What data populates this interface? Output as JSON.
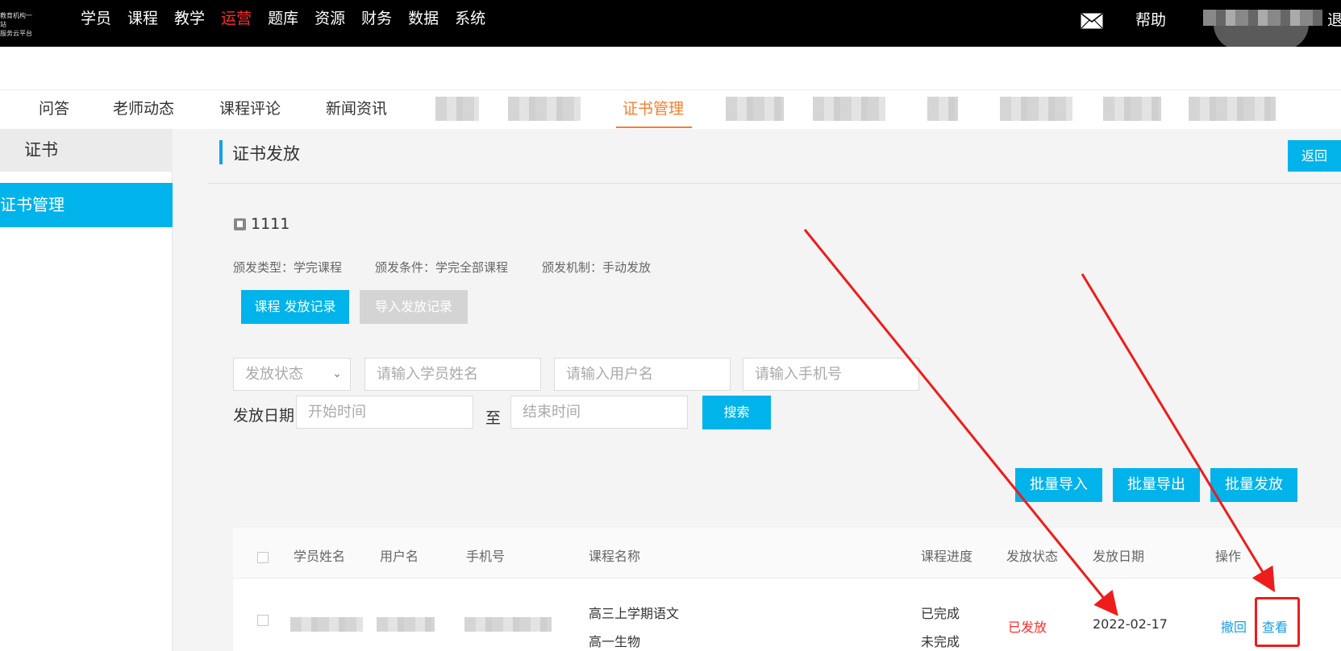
{
  "topnav": {
    "items": [
      "学员",
      "课程",
      "教学",
      "运营",
      "题库",
      "资源",
      "财务",
      "数据",
      "系统"
    ],
    "active": "运营",
    "help": "帮助",
    "logout": "退",
    "logo_line1": "教育机构一站",
    "logo_line2": "服务云平台"
  },
  "subtabs": {
    "items": [
      "问答",
      "老师动态",
      "课程评论",
      "新闻资讯",
      "证书管理"
    ],
    "active": "证书管理"
  },
  "sidebar": {
    "header": "证书",
    "items": [
      "证书管理"
    ]
  },
  "page": {
    "title": "证书发放",
    "back": "返回"
  },
  "certificate": {
    "name": "1111",
    "type_label": "颁发类型：学完课程",
    "condition_label": "颁发条件：学完全部课程",
    "mechanism_label": "颁发机制：手动发放"
  },
  "record_tabs": {
    "course_records": "课程 发放记录",
    "import_records": "导入发放记录"
  },
  "filters": {
    "status_placeholder": "发放状态",
    "student_placeholder": "请输入学员姓名",
    "username_placeholder": "请输入用户名",
    "phone_placeholder": "请输入手机号",
    "date_label": "发放日期",
    "start_placeholder": "开始时间",
    "to_label": "至",
    "end_placeholder": "结束时间",
    "search": "搜索"
  },
  "bulk_actions": {
    "import": "批量导入",
    "export": "批量导出",
    "issue": "批量发放"
  },
  "table": {
    "columns": [
      "学员姓名",
      "用户名",
      "手机号",
      "课程名称",
      "课程进度",
      "发放状态",
      "发放日期",
      "操作"
    ],
    "rows": [
      {
        "courses": [
          "高三上学期语文",
          "高一生物"
        ],
        "progress": [
          "已完成",
          "未完成"
        ],
        "status": "已发放",
        "date": "2022-02-17",
        "actions": [
          "撤回",
          "查看"
        ]
      }
    ]
  },
  "colors": {
    "accent": "#00b3ea",
    "active_nav": "#ff2d2d",
    "active_tab": "#f47f2e",
    "annotation": "#ee1c1c"
  }
}
